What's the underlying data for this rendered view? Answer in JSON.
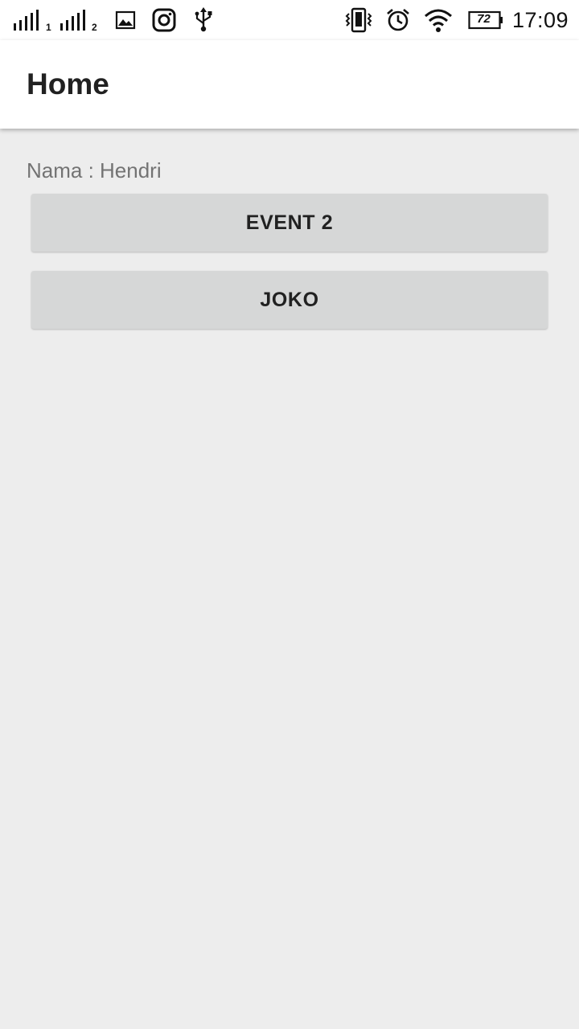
{
  "status_bar": {
    "sim1_label": "1",
    "sim2_label": "2",
    "icons": [
      "signal-sim1-icon",
      "signal-sim2-icon",
      "gallery-icon",
      "instagram-icon",
      "usb-icon",
      "vibrate-icon",
      "alarm-icon",
      "wifi-icon",
      "battery-icon"
    ],
    "battery_level": "72",
    "time": "17:09"
  },
  "app_bar": {
    "title": "Home"
  },
  "main": {
    "name_line": "Nama : Hendri",
    "buttons": [
      {
        "label": "EVENT 2"
      },
      {
        "label": "JOKO"
      }
    ]
  },
  "colors": {
    "background": "#ededed",
    "app_bar": "#ffffff",
    "button": "#d6d7d7",
    "title_text": "#212121",
    "secondary_text": "#737373"
  }
}
